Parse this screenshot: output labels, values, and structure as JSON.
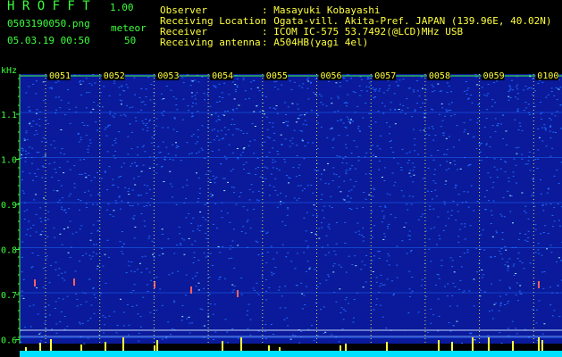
{
  "app": {
    "name": "H R O F F T",
    "version": "1.00"
  },
  "file": {
    "name": "0503190050.png",
    "date": "05.03.19 00:50"
  },
  "stats": {
    "label": "meteor",
    "count": "50"
  },
  "info": {
    "labels": [
      "Observer",
      "Receiving Location",
      "Receiver",
      "Receiving antenna"
    ],
    "values": [
      ": Masayuki Kobayashi",
      ": Ogata-vill. Akita-Pref. JAPAN (139.96E, 40.02N)",
      ": ICOM IC-575 53.7492(@LCD)MHz USB",
      ": A504HB(yagi 4el)"
    ]
  },
  "axis": {
    "y_unit": "kHz",
    "y_ticks": [
      "1.1",
      "1.0",
      "0.9",
      "0.8",
      "0.7",
      "0.6"
    ],
    "x_ticks": [
      "0051",
      "0052",
      "0053",
      "0054",
      "0055",
      "0056",
      "0057",
      "0058",
      "0059",
      "0100"
    ]
  },
  "colors": {
    "background": "#000000",
    "header_text": "#3cff3c",
    "values_text": "#ffff3c",
    "spectrum_base": "#0a1a9a",
    "spectrum_noise": "#1e6cff",
    "spectrum_peak": "#9ff0ff",
    "meteor_bars": "#ffff3c",
    "footer_bar": "#00e0ff"
  }
}
